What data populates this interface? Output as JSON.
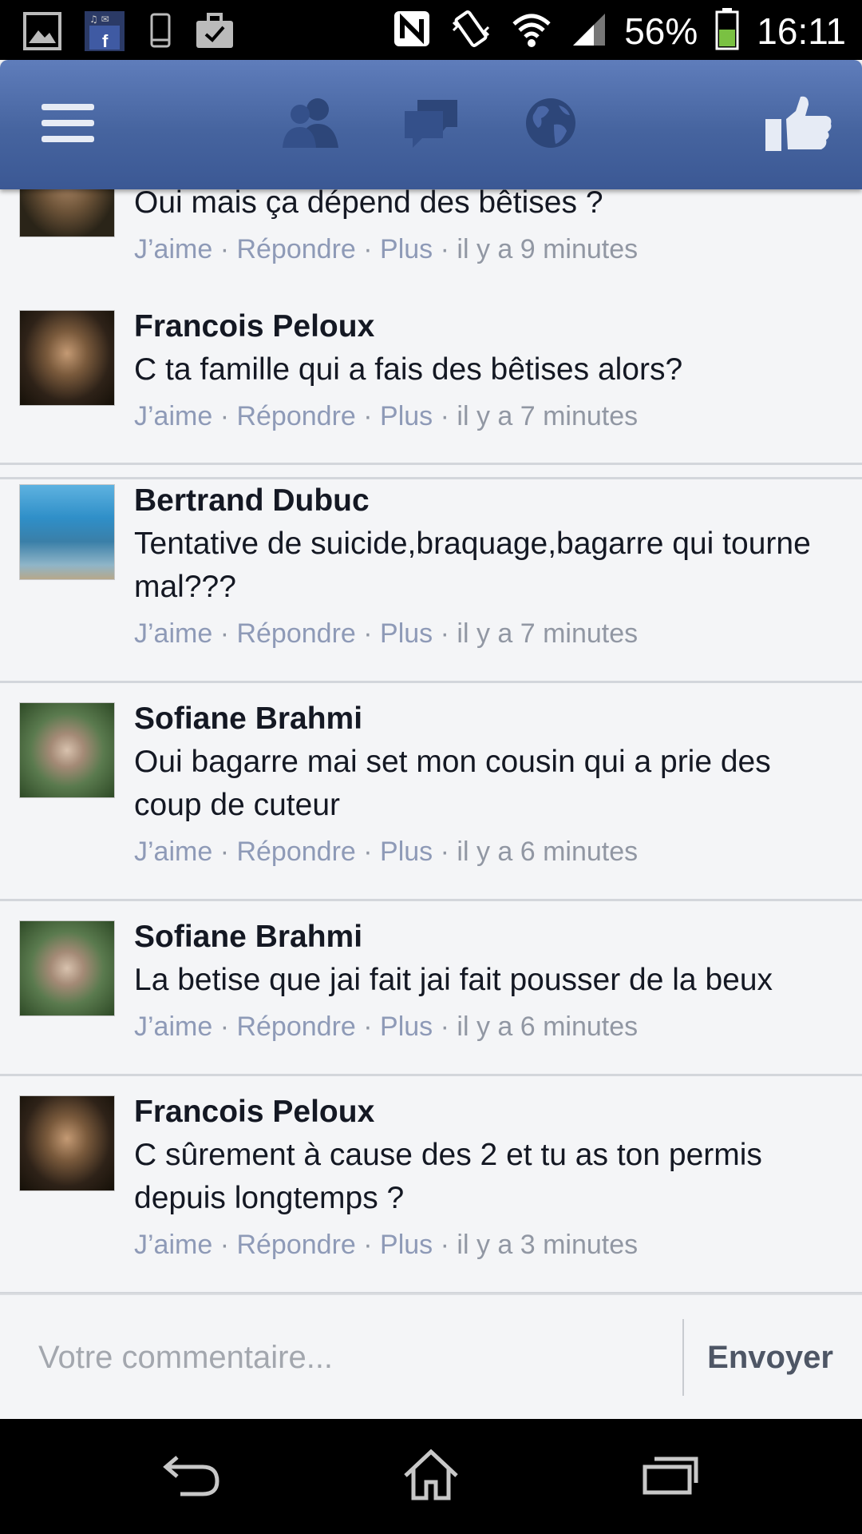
{
  "status_bar": {
    "battery": "56%",
    "time": "16:11",
    "icons": [
      "gallery-icon",
      "facebook-notification-icon",
      "phone-icon",
      "briefcase-icon",
      "nfc-icon",
      "vibrate-icon",
      "wifi-icon",
      "signal-icon",
      "battery-icon"
    ]
  },
  "navbar": {
    "icons": [
      "menu-icon",
      "friends-icon",
      "messages-icon",
      "globe-icon",
      "like-icon"
    ],
    "bg_color": "#46649f"
  },
  "comments": [
    {
      "name": "",
      "text": "Oui mais ça dépend des bêtises ?",
      "like": "J’aime",
      "reply": "Répondre",
      "more": "Plus",
      "sep": " · ",
      "time": "il y a 9 minutes"
    },
    {
      "name": "Francois Peloux",
      "text": "C ta famille qui a fais des bêtises alors?",
      "like": "J’aime",
      "reply": "Répondre",
      "more": "Plus",
      "sep": " · ",
      "time": "il y a 7 minutes"
    },
    {
      "name": "Bertrand Dubuc",
      "text": "Tentative de suicide,braquage,bagarre qui tourne mal???",
      "like": "J’aime",
      "reply": "Répondre",
      "more": "Plus",
      "sep": " · ",
      "time": "il y a 7 minutes"
    },
    {
      "name": "Sofiane Brahmi",
      "text": "Oui bagarre mai set mon cousin qui a prie des coup de cuteur",
      "like": "J’aime",
      "reply": "Répondre",
      "more": "Plus",
      "sep": " · ",
      "time": "il y a 6 minutes"
    },
    {
      "name": "Sofiane Brahmi",
      "text": "La betise que jai fait jai fait pousser de la beux",
      "like": "J’aime",
      "reply": "Répondre",
      "more": "Plus",
      "sep": " · ",
      "time": "il y a 6 minutes"
    },
    {
      "name": "Francois Peloux",
      "text": "C sûrement à cause des 2 et tu as ton permis depuis longtemps ?",
      "like": "J’aime",
      "reply": "Répondre",
      "more": "Plus",
      "sep": " · ",
      "time": "il y a 3 minutes"
    }
  ],
  "composer": {
    "placeholder": "Votre commentaire...",
    "send": "Envoyer"
  },
  "system_nav": {
    "icons": [
      "back-icon",
      "home-icon",
      "recent-apps-icon"
    ]
  }
}
